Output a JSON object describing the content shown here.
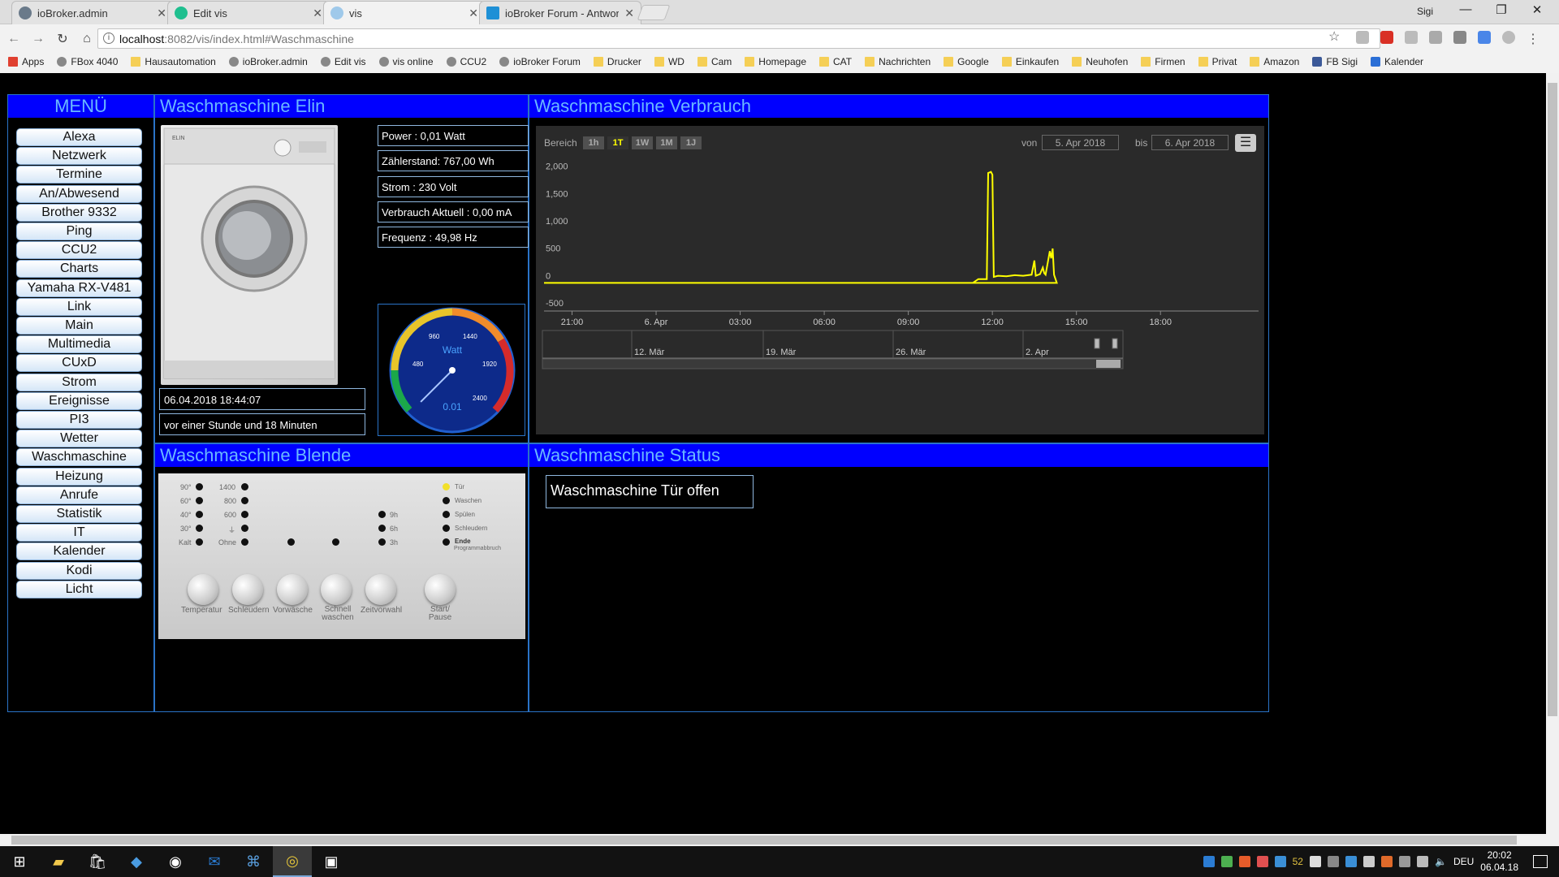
{
  "browser": {
    "tabs": [
      {
        "label": "ioBroker.admin",
        "icon_color": "#6a7a8a",
        "active": false
      },
      {
        "label": "Edit vis",
        "icon_color": "#1fbf8f",
        "active": false
      },
      {
        "label": "vis",
        "icon_color": "#9fc9ea",
        "active": true
      },
      {
        "label": "ioBroker Forum - Antwor",
        "icon_color": "#1e90d6",
        "active": false
      }
    ],
    "window_user": "Sigi",
    "url_host": "localhost",
    "url_path": ":8082/vis/index.html#Waschmaschine",
    "bookmarks": [
      {
        "label": "Apps",
        "icon": "apps-grid-icon"
      },
      {
        "label": "FBox 4040",
        "icon": "fritzbox-icon"
      },
      {
        "label": "Hausautomation",
        "icon": "folder-icon"
      },
      {
        "label": "ioBroker.admin",
        "icon": "iobroker-icon"
      },
      {
        "label": "Edit vis",
        "icon": "vis-icon"
      },
      {
        "label": "vis online",
        "icon": "vis-icon"
      },
      {
        "label": "CCU2",
        "icon": "page-icon"
      },
      {
        "label": "ioBroker Forum",
        "icon": "iobroker-forum-icon"
      },
      {
        "label": "Drucker",
        "icon": "folder-icon"
      },
      {
        "label": "WD",
        "icon": "folder-icon"
      },
      {
        "label": "Cam",
        "icon": "folder-icon"
      },
      {
        "label": "Homepage",
        "icon": "folder-icon"
      },
      {
        "label": "CAT",
        "icon": "folder-icon"
      },
      {
        "label": "Nachrichten",
        "icon": "folder-icon"
      },
      {
        "label": "Google",
        "icon": "folder-icon"
      },
      {
        "label": "Einkaufen",
        "icon": "folder-icon"
      },
      {
        "label": "Neuhofen",
        "icon": "folder-icon"
      },
      {
        "label": "Firmen",
        "icon": "folder-icon"
      },
      {
        "label": "Privat",
        "icon": "folder-icon"
      },
      {
        "label": "Amazon",
        "icon": "folder-icon"
      },
      {
        "label": "FB Sigi",
        "icon": "facebook-icon"
      },
      {
        "label": "Kalender",
        "icon": "calendar-icon"
      }
    ]
  },
  "menu": {
    "title": "MENÜ",
    "items": [
      "Alexa",
      "Netzwerk",
      "Termine",
      "An/Abwesend",
      "Brother 9332",
      "Ping",
      "CCU2",
      "Charts",
      "Yamaha RX-V481",
      "Link",
      "Main",
      "Multimedia",
      "CUxD",
      "Strom",
      "Ereignisse",
      "PI3",
      "Wetter",
      "Waschmaschine",
      "Heizung",
      "Anrufe",
      "Statistik",
      "IT",
      "Kalender",
      "Kodi",
      "Licht"
    ]
  },
  "elin": {
    "title": "Waschmaschine Elin",
    "power": "Power : 0,01 Watt",
    "meter": "Zählerstand: 767,00 Wh",
    "voltage": "Strom : 230 Volt",
    "current": "Verbrauch Aktuell : 0,00 mA",
    "frequency": "Frequenz : 49,98 Hz",
    "timestamp": "06.04.2018 18:44:07",
    "ago": "vor einer Stunde und 18 Minuten",
    "gauge": {
      "label": "Watt",
      "value": 0.01,
      "value_text": "0.01",
      "max": 2400,
      "ticks": [
        "480",
        "960",
        "1440",
        "1920",
        "2400"
      ]
    }
  },
  "verbrauch": {
    "title": "Waschmaschine Verbrauch",
    "range_label": "Bereich",
    "range_buttons": [
      "1h",
      "1T",
      "1W",
      "1M",
      "1J"
    ],
    "range_selected": "1T",
    "from_label": "von",
    "from_value": "5. Apr 2018",
    "to_label": "bis",
    "to_value": "6. Apr 2018",
    "navigator_labels": [
      "12. Mär",
      "19. Mär",
      "26. Mär",
      "2. Apr"
    ]
  },
  "chart_data": {
    "type": "line",
    "title": "",
    "xlabel": "",
    "ylabel": "",
    "x_ticks": [
      "21:00",
      "6. Apr",
      "03:00",
      "06:00",
      "09:00",
      "12:00",
      "15:00",
      "18:00"
    ],
    "y_ticks": [
      "2,000",
      "1,500",
      "1,000",
      "500",
      "0",
      "-500"
    ],
    "ylim": [
      -500,
      2100
    ],
    "xlim_hours": [
      20,
      21.5
    ],
    "series": [
      {
        "color": "#ffff00",
        "points": [
          [
            20.0,
            -30
          ],
          [
            9.0,
            -30
          ],
          [
            11.3,
            -30
          ],
          [
            11.5,
            40
          ],
          [
            11.8,
            40
          ],
          [
            11.85,
            1980
          ],
          [
            11.95,
            2000
          ],
          [
            12.0,
            1950
          ],
          [
            12.05,
            80
          ],
          [
            12.2,
            100
          ],
          [
            12.5,
            90
          ],
          [
            12.8,
            110
          ],
          [
            13.1,
            100
          ],
          [
            13.4,
            120
          ],
          [
            13.5,
            380
          ],
          [
            13.55,
            100
          ],
          [
            13.7,
            130
          ],
          [
            13.8,
            250
          ],
          [
            13.85,
            150
          ],
          [
            13.9,
            120
          ],
          [
            14.05,
            550
          ],
          [
            14.1,
            420
          ],
          [
            14.15,
            600
          ],
          [
            14.2,
            120
          ],
          [
            14.3,
            -30
          ],
          [
            21.5,
            -30
          ]
        ]
      }
    ]
  },
  "blende": {
    "title": "Waschmaschine Blende",
    "temps": [
      "90°",
      "60°",
      "40°",
      "30°",
      "Kalt"
    ],
    "spins": [
      "1400",
      "800",
      "600",
      "",
      "Ohne"
    ],
    "timers": [
      "9h",
      "6h",
      "3h"
    ],
    "programs": [
      "Tür",
      "Waschen",
      "Spülen",
      "Schleudern",
      "Ende"
    ],
    "program_sub": "Programmabbruch",
    "knobs": [
      "Temperatur",
      "Schleudern",
      "Vorwäsche",
      "Schnell waschen",
      "Zeitvorwahl",
      "Start/ Pause"
    ]
  },
  "status": {
    "title": "Waschmaschine Status",
    "door": "Waschmaschine Tür offen"
  },
  "taskbar": {
    "lang": "DEU",
    "time": "20:02",
    "date": "06.04.18",
    "tray_count": "52"
  }
}
